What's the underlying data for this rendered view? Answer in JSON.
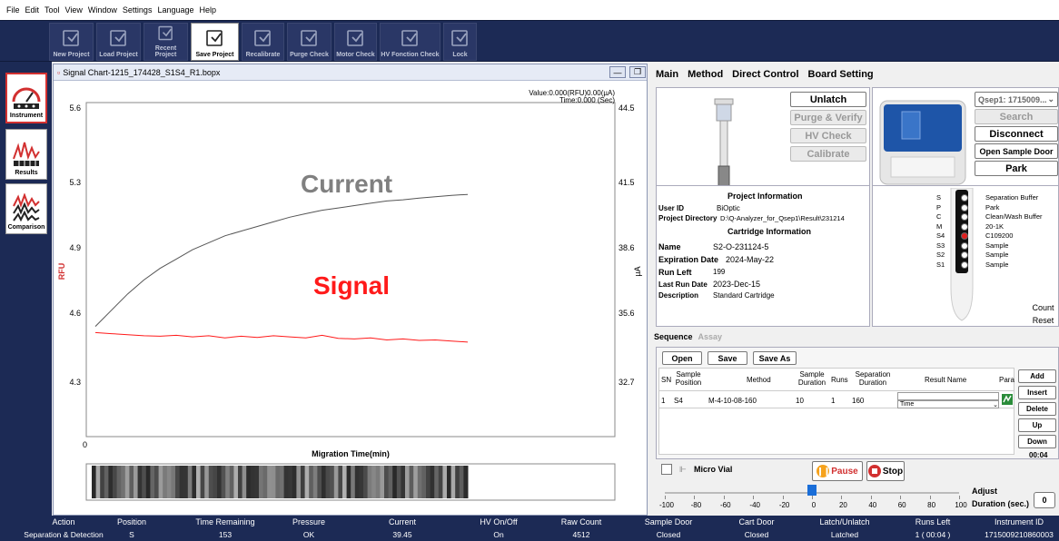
{
  "menu": [
    "File",
    "Edit",
    "Tool",
    "View",
    "Window",
    "Settings",
    "Language",
    "Help"
  ],
  "toolbar": [
    {
      "label": "New Project",
      "icon": "new-project-icon",
      "active": false
    },
    {
      "label": "Load Project",
      "icon": "load-project-icon",
      "active": false
    },
    {
      "label": "Recent Project",
      "icon": "recent-project-icon",
      "active": false
    },
    {
      "label": "Save Project",
      "icon": "save-project-icon",
      "active": true
    },
    {
      "label": "Recalibrate",
      "icon": "recalibrate-icon",
      "active": false
    },
    {
      "label": "Purge Check",
      "icon": "purge-check-icon",
      "active": false
    },
    {
      "label": "Motor Check",
      "icon": "motor-check-icon",
      "active": false
    },
    {
      "label": "HV Fonction Check",
      "icon": "hv-check-icon",
      "active": false
    },
    {
      "label": "Lock",
      "icon": "lock-icon",
      "active": false
    }
  ],
  "nav": [
    {
      "label": "Instrument",
      "icon": "gauge-icon",
      "active": true
    },
    {
      "label": "Results",
      "icon": "results-chart-icon",
      "active": false
    },
    {
      "label": "Comparison",
      "icon": "comparison-chart-icon",
      "active": false
    }
  ],
  "chart_window": {
    "title": "Signal Chart-1215_174428_S1S4_R1.bopx",
    "readout_value": "Value:0.000(RFU)0.00(µA)",
    "readout_time": "Time:0.000 (Sec)",
    "overlay_current": "Current",
    "overlay_signal": "Signal",
    "current_color": "#808080",
    "signal_color": "#ff1a1a"
  },
  "chart_data": {
    "type": "line",
    "xlabel": "Migration Time(min)",
    "ylabel": "RFU",
    "y2label": "µA",
    "x_tick_labels": [
      "0"
    ],
    "y_ticks": [
      "5.6",
      "5.3",
      "4.9",
      "4.6",
      "4.3"
    ],
    "y2_ticks": [
      "44.5",
      "41.5",
      "38.6",
      "35.6",
      "32.7"
    ],
    "ylim": [
      4.3,
      5.6
    ],
    "y2lim": [
      32.7,
      44.5
    ],
    "series": [
      {
        "color": "#555555",
        "axis": "right",
        "values": [
          35.1,
          35.8,
          36.5,
          37.1,
          37.6,
          38.0,
          38.4,
          38.7,
          39.0,
          39.2,
          39.4,
          39.6,
          39.8,
          39.95,
          40.1,
          40.2,
          40.3,
          40.4,
          40.5,
          40.55,
          40.62,
          40.68,
          40.74,
          40.78
        ]
      },
      {
        "color": "#ff1a1a",
        "axis": "left",
        "values": [
          4.535,
          4.53,
          4.525,
          4.52,
          4.518,
          4.522,
          4.515,
          4.52,
          4.51,
          4.518,
          4.512,
          4.52,
          4.515,
          4.51,
          4.522,
          4.508,
          4.505,
          4.51,
          4.5,
          4.505,
          4.498,
          4.5,
          4.495,
          4.49
        ]
      }
    ]
  },
  "right_tabs": [
    "Main",
    "Method",
    "Direct Control",
    "Board Setting"
  ],
  "controls": {
    "unlatch": "Unlatch",
    "purge": "Purge & Verify",
    "hv": "HV Check",
    "calibrate": "Calibrate",
    "device_select": "Qsep1: 1715009...",
    "search": "Search",
    "disconnect": "Disconnect",
    "open_door": "Open Sample Door",
    "park": "Park"
  },
  "project": {
    "heading": "Project Information",
    "user_label": "User ID",
    "user": "BiOptic",
    "dir_label": "Project Directory",
    "dir": "D:\\Q-Analyzer_for_Qsep1\\Result\\231214",
    "cart_heading": "Cartridge Information",
    "name_label": "Name",
    "name": "S2-O-231124-5",
    "exp_label": "Expiration Date",
    "exp": "2024-May-22",
    "runs_label": "Run Left",
    "runs": "199",
    "last_label": "Last Run Date",
    "last": "2023-Dec-15",
    "desc_label": "Description",
    "desc": "Standard Cartridge"
  },
  "slots": [
    {
      "code": "S",
      "desc": "Separation Buffer"
    },
    {
      "code": "P",
      "desc": "Park"
    },
    {
      "code": "C",
      "desc": "Clean/Wash Buffer"
    },
    {
      "code": "M",
      "desc": "20-1K"
    },
    {
      "code": "S4",
      "desc": "C109200"
    },
    {
      "code": "S3",
      "desc": "Sample"
    },
    {
      "code": "S2",
      "desc": "Sample"
    },
    {
      "code": "S1",
      "desc": "Sample"
    }
  ],
  "count_reset": [
    "Count",
    "Reset"
  ],
  "sequence": {
    "tabs": [
      "Sequence",
      "Assay"
    ],
    "open": "Open",
    "save": "Save",
    "save_as": "Save As",
    "headers": [
      "SN",
      "Sample Position",
      "Method",
      "Sample Duration",
      "Runs",
      "Separation Duration",
      "Result Name",
      "Para"
    ],
    "row": {
      "sn": "1",
      "pos": "S4",
      "method": "M-4-10-08-160",
      "dur": "10",
      "runs": "1",
      "sep": "160",
      "result": "",
      "result_sel": "Time"
    },
    "side_buttons": [
      "Add",
      "Insert",
      "Delete",
      "Up",
      "Down"
    ],
    "elapsed": "00:04"
  },
  "micro_vial": "Micro Vial",
  "pause": "Pause",
  "stop": "Stop",
  "slider": {
    "ticks": [
      "-100",
      "-80",
      "-60",
      "-40",
      "-20",
      "0",
      "20",
      "40",
      "60",
      "80",
      "100"
    ],
    "value": 0
  },
  "adjust_label": "Adjust",
  "duration_label": "Duration (sec.)",
  "duration_value": "0",
  "status": {
    "headers": [
      "Action",
      "Position",
      "Time Remaining",
      "Pressure",
      "Current",
      "HV On/Off",
      "Raw Count",
      "Sample Door",
      "Cart Door",
      "Latch/Unlatch",
      "Runs Left",
      "Instrument ID"
    ],
    "values": [
      "Separation & Detection",
      "S",
      "153",
      "OK",
      "39.45",
      "On",
      "4512",
      "Closed",
      "Closed",
      "Latched",
      "1 ( 00:04 )",
      "1715009210860003"
    ]
  }
}
